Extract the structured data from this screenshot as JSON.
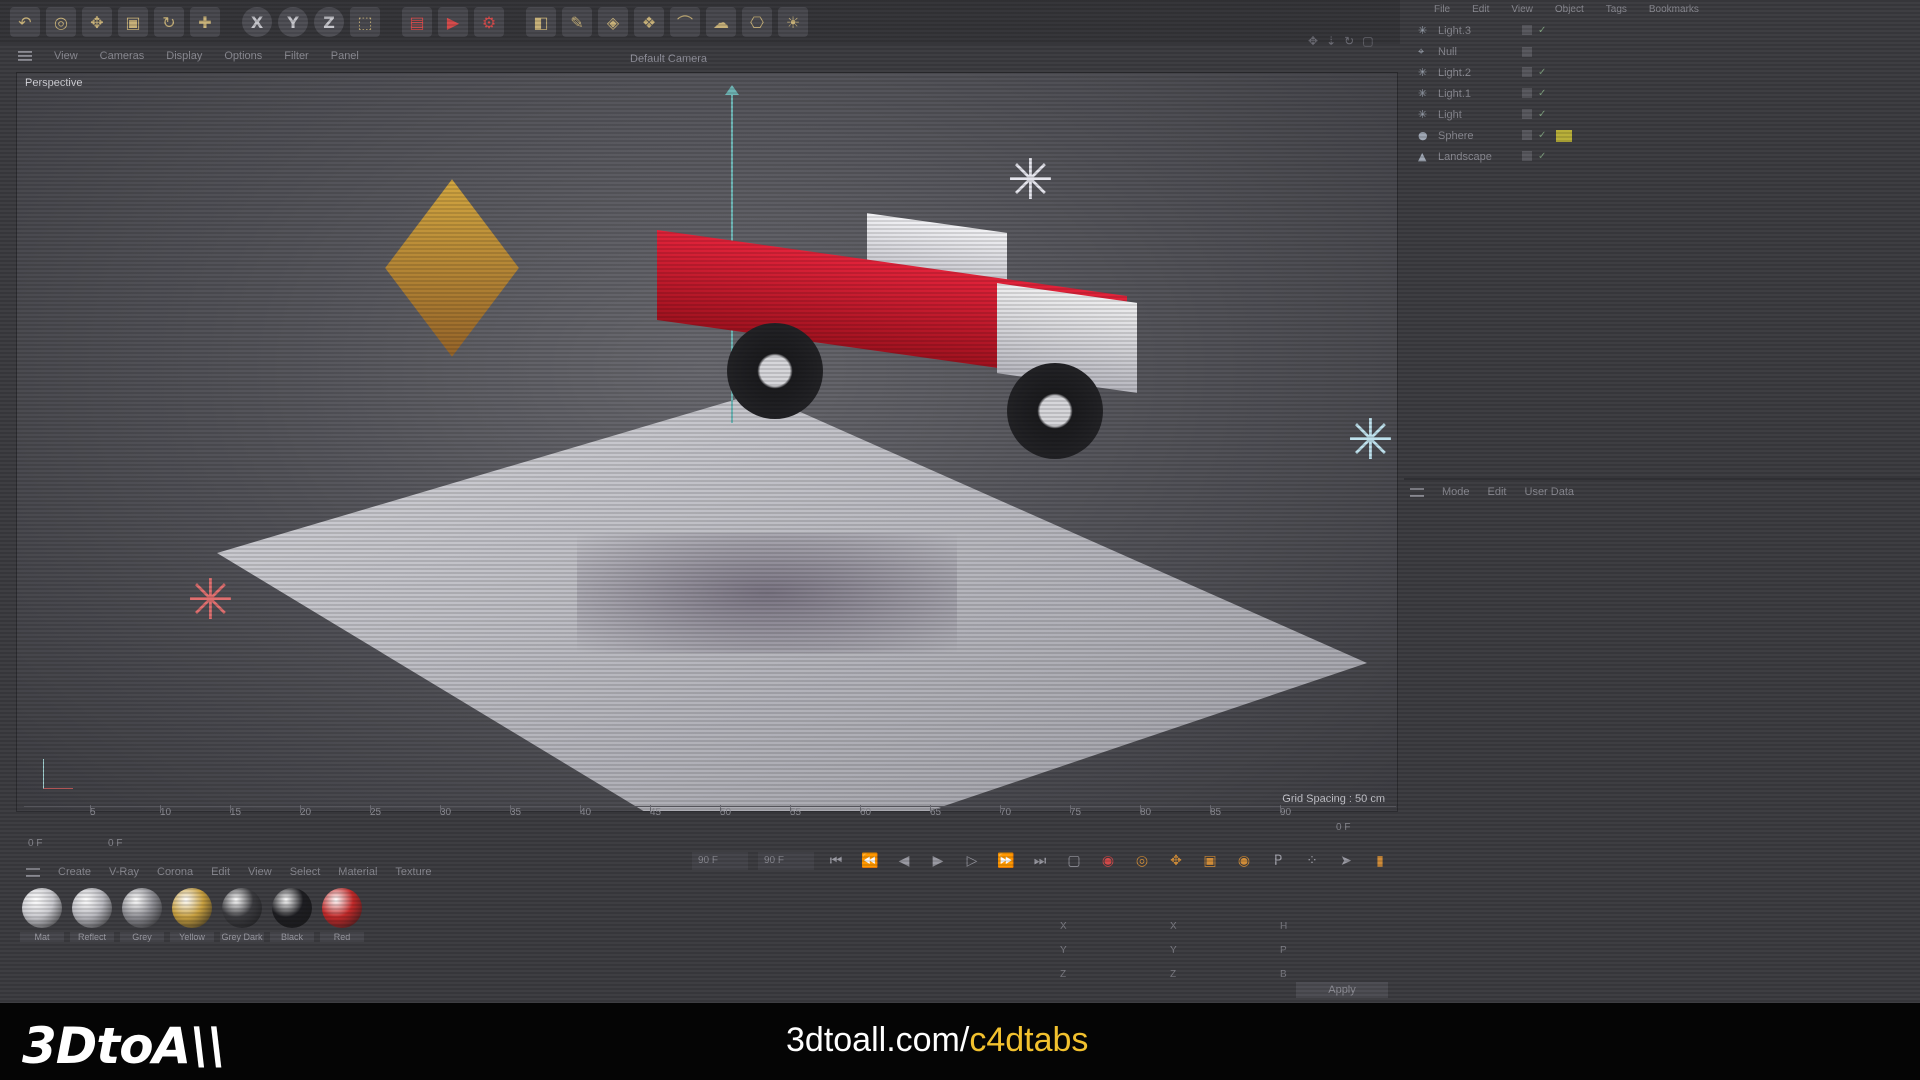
{
  "toolbar": {
    "axis_buttons": [
      "X",
      "Y",
      "Z"
    ]
  },
  "viewport": {
    "menu": [
      "View",
      "Cameras",
      "Display",
      "Options",
      "Filter",
      "Panel"
    ],
    "camera": "Default Camera",
    "label": "Perspective",
    "grid_spacing": "Grid Spacing : 50 cm"
  },
  "object_manager": {
    "menu": [
      "File",
      "Edit",
      "View",
      "Object",
      "Tags",
      "Bookmarks"
    ],
    "objects": [
      {
        "name": "Light.3",
        "icon": "light-icon"
      },
      {
        "name": "Null",
        "icon": "null-icon"
      },
      {
        "name": "Light.2",
        "icon": "light-icon"
      },
      {
        "name": "Light.1",
        "icon": "light-icon"
      },
      {
        "name": "Light",
        "icon": "light-icon"
      },
      {
        "name": "Sphere",
        "icon": "sphere-icon"
      },
      {
        "name": "Landscape",
        "icon": "landscape-icon"
      }
    ]
  },
  "attribute_manager": {
    "menu": [
      "Mode",
      "Edit",
      "User Data"
    ]
  },
  "timeline": {
    "ticks": [
      "5",
      "10",
      "15",
      "20",
      "25",
      "30",
      "35",
      "40",
      "45",
      "50",
      "55",
      "60",
      "65",
      "70",
      "75",
      "80",
      "85",
      "90"
    ],
    "start_frame": "0 F",
    "current_frame": "0 F",
    "end_frame": "0 F"
  },
  "transport": {
    "field_a": "90 F",
    "field_b": "90 F"
  },
  "material_manager": {
    "menu": [
      "Create",
      "V-Ray",
      "Corona",
      "Edit",
      "View",
      "Select",
      "Material",
      "Texture"
    ],
    "materials": [
      {
        "name": "Mat",
        "color": "#c9c9ce"
      },
      {
        "name": "Reflect",
        "color": "#b9b9bf"
      },
      {
        "name": "Grey",
        "color": "#8e8e94"
      },
      {
        "name": "Yellow",
        "color": "#c8a040"
      },
      {
        "name": "Grey Dark",
        "color": "#3c3c40"
      },
      {
        "name": "Black",
        "color": "#1e1e22"
      },
      {
        "name": "Red",
        "color": "#c22a2a"
      }
    ]
  },
  "coordinates": {
    "rows": [
      {
        "a": "X",
        "b": "X",
        "c": "H"
      },
      {
        "a": "Y",
        "b": "Y",
        "c": "P"
      },
      {
        "a": "Z",
        "b": "Z",
        "c": "B"
      }
    ],
    "apply_label": "Apply"
  },
  "branding": {
    "logo": "3DtoA\\\\",
    "url_prefix": "3dtoall.com/",
    "url_highlight": "c4dtabs"
  }
}
